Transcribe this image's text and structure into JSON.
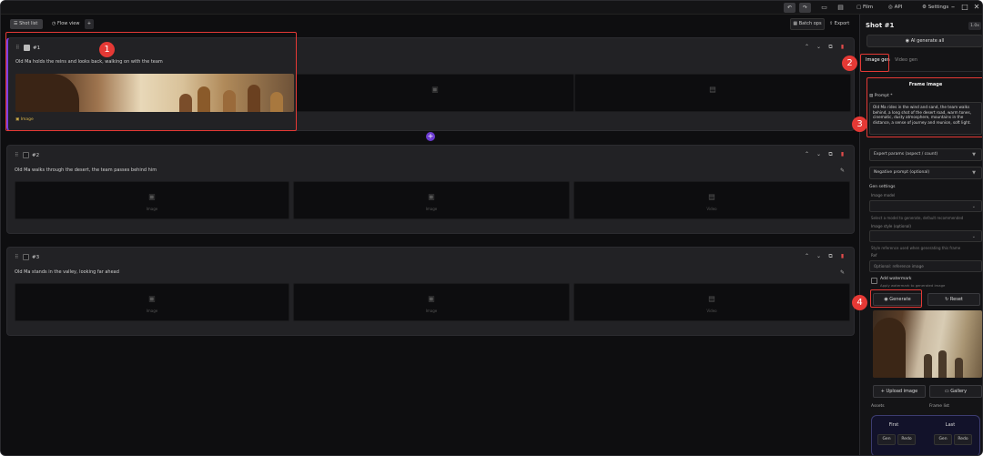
{
  "toolbar": {
    "view_label": "Film",
    "account_label": "Account",
    "api_label": "API",
    "settings_label": "Settings",
    "undo_icon": "undo-icon",
    "redo_icon": "redo-icon"
  },
  "subbar": {
    "tab_list": "Shot list",
    "tab_flow": "Flow view",
    "tab_plus": "+",
    "batch_label": "Batch ops",
    "export_label": "Export"
  },
  "shots": [
    {
      "num": "#1",
      "desc": "Old Ma holds the reins and looks back, walking on with the team",
      "badge": "Image"
    },
    {
      "num": "#2",
      "desc": "Old Ma walks through the desert, the team passes behind him",
      "badge": ""
    },
    {
      "num": "#3",
      "desc": "Old Ma stands in the valley, looking far ahead",
      "badge": ""
    }
  ],
  "slot_labels": {
    "image": "Image",
    "video": "Video"
  },
  "panel": {
    "title": "Shot #1",
    "zoom": "1.0x",
    "gen_all": "AI generate all",
    "tab_image": "Image gen",
    "tab_video": "Video gen",
    "section_header": "Frame image",
    "prompt_label": "Prompt *",
    "prompt_text": "Old Ma rides in the wind and sand, the team walks behind, a long shot of the desert road, warm tones, cinematic, dusty atmosphere, mountains in the distance, a sense of journey and reunion, soft light.",
    "dropdown1": "Expert params (aspect / count)",
    "dropdown2": "Negative prompt (optional)",
    "gen_settings": "Gen settings",
    "model_label": "Image model",
    "model_hint": "Select a model to generate, default recommended",
    "style_label": "Image style (optional)",
    "style_hint": "Style reference used when generating this frame",
    "ref_label": "Ref",
    "ref_placeholder": "Optional: reference image",
    "watermark_label": "Add watermark",
    "watermark_hint": "Apply watermark to generated image",
    "generate_btn": "Generate",
    "refresh_btn": "Reset",
    "upload_btn": "Upload image",
    "gallery_btn": "Gallery",
    "footer_left": "Assets",
    "footer_right": "Frame list",
    "first_frame": "First",
    "last_frame": "Last",
    "gen_short": "Gen",
    "redo_short": "Redo"
  },
  "annotations": [
    "1",
    "2",
    "3",
    "4"
  ],
  "colors": {
    "accent": "#6c3bd1",
    "annotation": "#e53935",
    "delete": "#e24b4b"
  }
}
